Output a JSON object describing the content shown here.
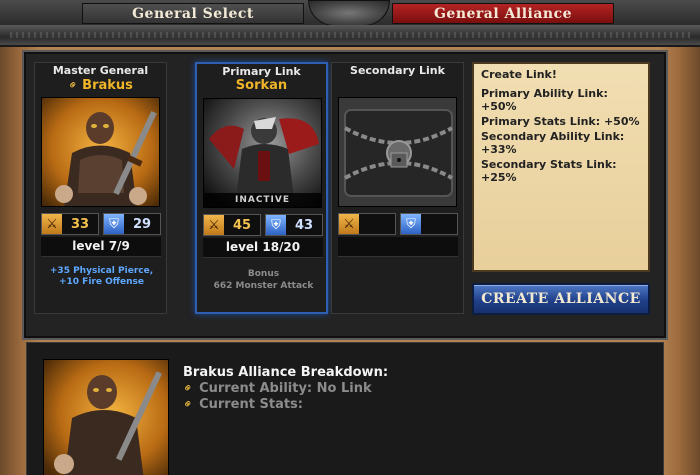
{
  "tabs": {
    "general_select": "General Select",
    "general_alliance": "General Alliance"
  },
  "slots": {
    "master": {
      "title": "Master General",
      "name": "Brakus",
      "attack": "33",
      "defense": "29",
      "level": "level 7/9",
      "bonus": "+35 Physical Pierce, +10 Fire Offense"
    },
    "primary": {
      "title": "Primary Link",
      "name": "Sorkan",
      "status": "INACTIVE",
      "attack": "45",
      "defense": "43",
      "level": "level 18/20",
      "bonus_label": "Bonus",
      "bonus_value": "662 Monster Attack"
    },
    "secondary": {
      "title": "Secondary Link"
    }
  },
  "info": {
    "heading": "Create Link!",
    "primary_ability": "Primary Ability Link: +50%",
    "primary_stats": "Primary Stats Link: +50%",
    "secondary_ability": "Secondary Ability Link: +33%",
    "secondary_stats": "Secondary Stats Link: +25%"
  },
  "create_button": "Create Alliance",
  "breakdown": {
    "title": "Brakus Alliance Breakdown:",
    "current_ability": "Current Ability: No Link",
    "current_stats": "Current Stats:"
  },
  "colors": {
    "accent_gold": "#f0b429",
    "active_blue": "#2f5fb0",
    "tab_red": "#b52323"
  },
  "icons": [
    "link-icon",
    "attack-axe-icon",
    "defense-shield-icon",
    "chain-lock-icon"
  ]
}
